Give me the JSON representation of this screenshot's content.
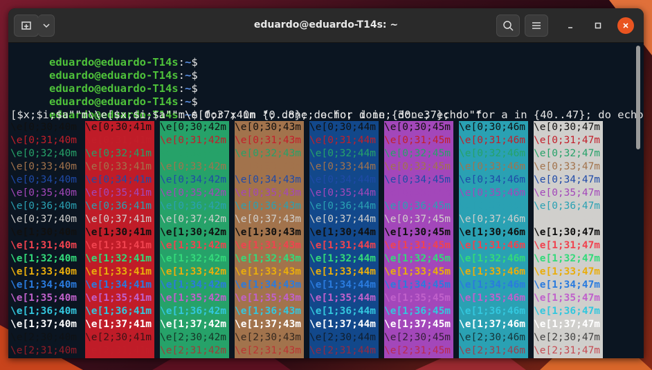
{
  "window": {
    "title": "eduardo@eduardo-T14s: ~",
    "buttons": {
      "new_tab_icon": "new-tab-icon",
      "menu_icon": "chevron-down-icon",
      "search_icon": "search-icon",
      "hamburger_icon": "hamburger-icon",
      "minimize_icon": "minimize-icon",
      "maximize_icon": "maximize-icon",
      "close_icon": "close-icon"
    }
  },
  "terminal": {
    "prompt_user": "eduardo@eduardo-T14s",
    "prompt_sep": ":",
    "prompt_path": "~",
    "prompt_symbol": "$",
    "command": " for x in {0..8}; do for i in {30..37}; do for a in {40..47}; do echo -ne \"\\e",
    "command_cont": "[$x;$i;$a\"\"m\\\\e[$x;$i;$a\"\"m\\e[0;37;40m \"; done; echo; done; done; echo \"\"",
    "colors": {
      "prompt_green": "#4ec23a",
      "prompt_blue": "#5b8fe0",
      "default_text": "#e6e6e6",
      "bg_terminal": "#0b1521",
      "fg": {
        "30": "#101010",
        "31": "#c21f2a",
        "32": "#26a269",
        "33": "#a2734c",
        "34": "#1f4aa8",
        "35": "#a347ba",
        "36": "#2aa1b3",
        "37": "#d0cfcc"
      },
      "fg_bright": {
        "31": "#f0434f",
        "32": "#33da7a",
        "33": "#e9ad0c",
        "34": "#2a7bde",
        "35": "#c061cb",
        "36": "#33c7de",
        "37": "#ffffff"
      },
      "bg": {
        "40": "#0b1521",
        "41": "#c01c28",
        "42": "#26a269",
        "43": "#a2734c",
        "44": "#12488b",
        "45": "#a347ba",
        "46": "#2aa1b3",
        "47": "#d0cfcc"
      }
    },
    "grid": {
      "bold_rows": [
        "0",
        "0",
        "0",
        "0",
        "0",
        "0",
        "0",
        "0",
        "1",
        "1",
        "1",
        "1",
        "1",
        "1",
        "1",
        "1",
        "2",
        "2"
      ],
      "fg_rows": [
        "30",
        "31",
        "32",
        "33",
        "34",
        "35",
        "36",
        "37",
        "30",
        "31",
        "32",
        "33",
        "34",
        "35",
        "36",
        "37",
        "30",
        "31"
      ],
      "bg_cols": [
        "40",
        "41",
        "42",
        "43",
        "44",
        "45",
        "46",
        "47"
      ]
    }
  }
}
